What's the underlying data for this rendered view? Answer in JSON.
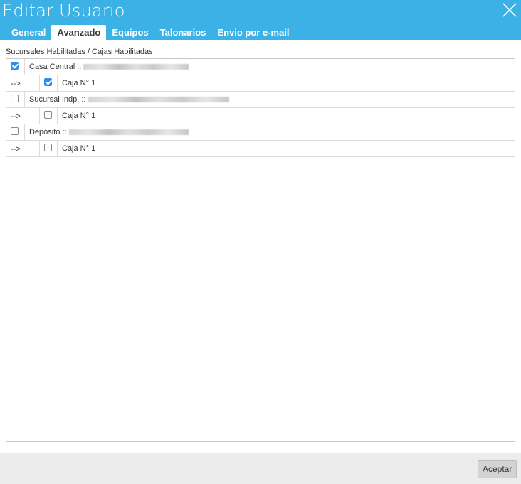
{
  "dialog": {
    "title": "Editar Usuario"
  },
  "tabs": [
    {
      "label": "General",
      "active": false
    },
    {
      "label": "Avanzado",
      "active": true
    },
    {
      "label": "Equipos",
      "active": false
    },
    {
      "label": "Talonarios",
      "active": false
    },
    {
      "label": "Envio por e-mail",
      "active": false
    }
  ],
  "section": {
    "label": "Sucursales Habilitadas / Cajas Habilitadas"
  },
  "branches": [
    {
      "label": "Casa Central ::",
      "checked": true,
      "cashbox": {
        "arrow": "-->",
        "label": "Caja N° 1",
        "checked": true
      }
    },
    {
      "label": "Sucursal Indp. ::",
      "checked": false,
      "cashbox": {
        "arrow": "-->",
        "label": "Caja N° 1",
        "checked": false
      }
    },
    {
      "label": "Depósito ::",
      "checked": false,
      "cashbox": {
        "arrow": "-->",
        "label": "Caja N° 1",
        "checked": false
      }
    }
  ],
  "footer": {
    "accept_label": "Aceptar"
  },
  "colors": {
    "header": "#3cb1e5",
    "checkbox_checked": "#2a8ef0",
    "footer": "#ececec"
  }
}
